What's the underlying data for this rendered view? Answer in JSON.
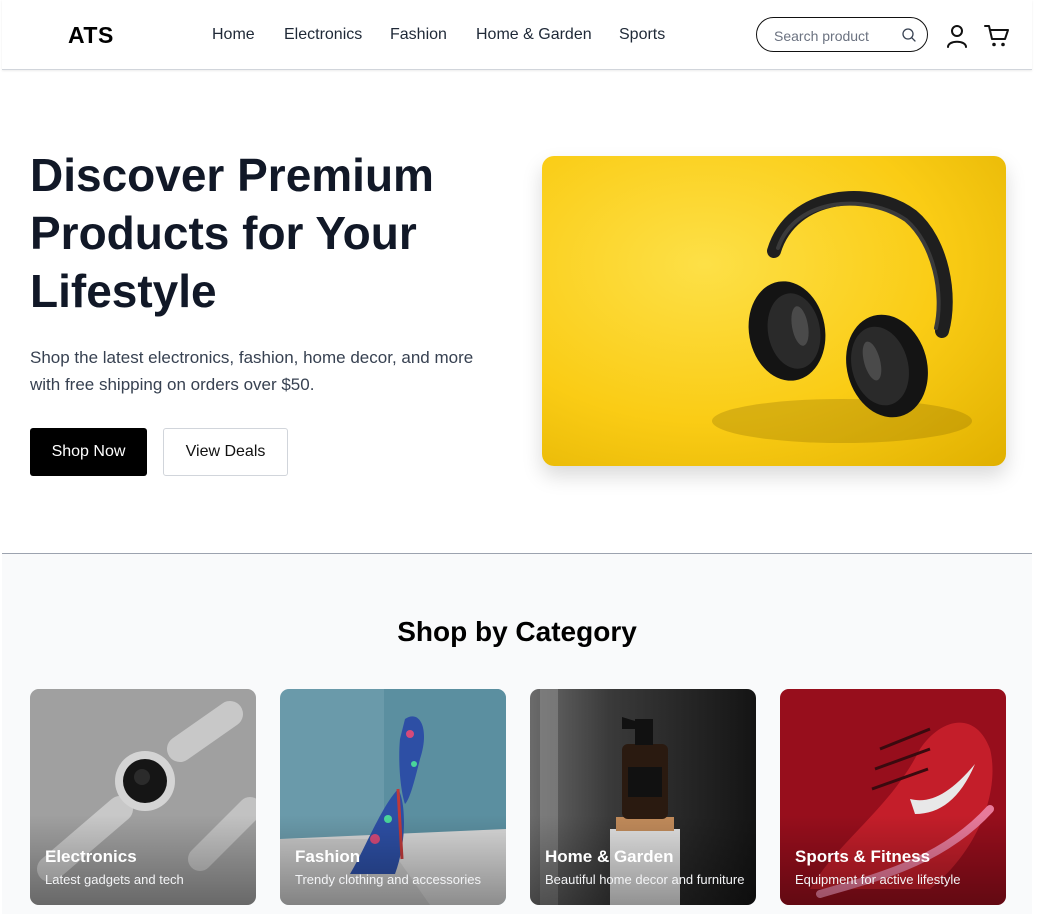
{
  "header": {
    "logo": "ATS",
    "nav": [
      "Home",
      "Electronics",
      "Fashion",
      "Home & Garden",
      "Sports"
    ],
    "search_placeholder": "Search product",
    "icons": {
      "search": "search-icon",
      "user": "user-icon",
      "cart": "cart-icon"
    }
  },
  "hero": {
    "title": "Discover Premium Products for Your Lifestyle",
    "subtitle": "Shop the latest electronics, fashion, home decor, and more with free shipping on orders over $50.",
    "primary_button": "Shop Now",
    "secondary_button": "View Deals",
    "image": "yellow-headphones-image"
  },
  "categories": {
    "title": "Shop by Category",
    "items": [
      {
        "name": "Electronics",
        "description": "Latest gadgets and tech",
        "image": "smartwatch-image"
      },
      {
        "name": "Fashion",
        "description": "Trendy clothing and accessories",
        "image": "floral-heels-image"
      },
      {
        "name": "Home & Garden",
        "description": "Beautiful home decor and furniture",
        "image": "spray-bottle-image"
      },
      {
        "name": "Sports & Fitness",
        "description": "Equipment for active lifestyle",
        "image": "red-sneaker-image"
      }
    ]
  },
  "colors": {
    "primary_button": "#000000",
    "hero_background": "#facc15",
    "section_background": "#f9fafb"
  }
}
